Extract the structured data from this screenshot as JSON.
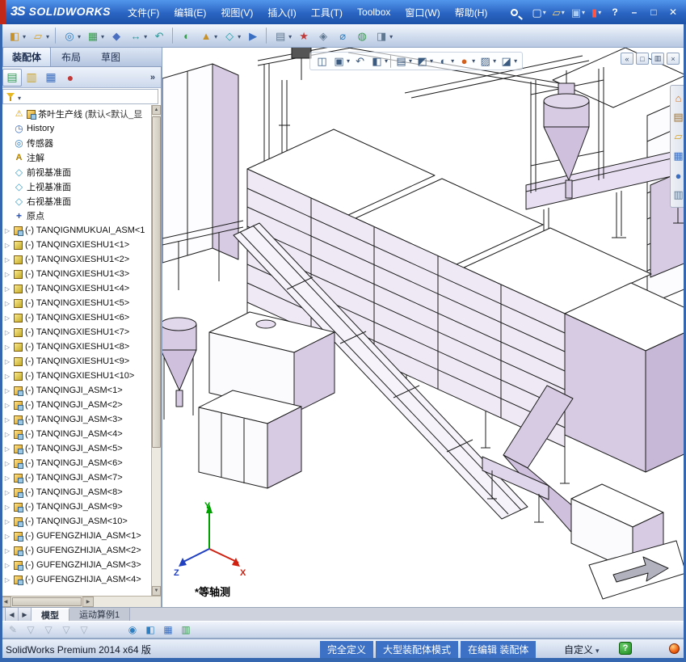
{
  "title_bar": {
    "logo_prefix": "3S",
    "logo_text": "SOLIDWORKS",
    "menus": [
      "文件(F)",
      "编辑(E)",
      "视图(V)",
      "插入(I)",
      "工具(T)",
      "Toolbox",
      "窗口(W)",
      "帮助(H)"
    ],
    "quick_icons": [
      {
        "name": "new-document-button",
        "glyph": "▢",
        "color": "#f0f6ff",
        "dropdown": true
      },
      {
        "name": "open-document-button",
        "glyph": "▱",
        "color": "#ffd878",
        "dropdown": true
      },
      {
        "name": "save-document-button",
        "glyph": "▣",
        "color": "#a8ccf4",
        "dropdown": true
      },
      {
        "name": "record-macro-button",
        "glyph": "▮",
        "color": "#ff5545",
        "dropdown": true
      }
    ],
    "window_controls": [
      {
        "name": "help-button",
        "glyph": "?"
      },
      {
        "name": "minimize-button",
        "glyph": "–"
      },
      {
        "name": "maximize-button",
        "glyph": "□"
      },
      {
        "name": "close-button",
        "glyph": "✕"
      }
    ]
  },
  "main_toolbar": {
    "icons": [
      {
        "name": "insert-component",
        "glyph": "◧",
        "color": "#c8922a",
        "dropdown": true
      },
      {
        "name": "open-part",
        "glyph": "▱",
        "color": "#d8a020",
        "dropdown": true
      },
      {
        "sep": true
      },
      {
        "name": "mate",
        "glyph": "◎",
        "color": "#2f7fc0",
        "dropdown": true
      },
      {
        "name": "component-pattern",
        "glyph": "▦",
        "color": "#3a9a50",
        "dropdown": true
      },
      {
        "name": "smart-fasteners",
        "glyph": "◆",
        "color": "#4a6ec0"
      },
      {
        "name": "move-component",
        "glyph": "↔",
        "color": "#2f9a9a",
        "dropdown": true
      },
      {
        "name": "rotate-component",
        "glyph": "↶",
        "color": "#2f9a9a"
      },
      {
        "sep": true
      },
      {
        "name": "show-hidden-components",
        "glyph": "◐",
        "color": "#3a9a50"
      },
      {
        "name": "assembly-features",
        "glyph": "▲",
        "color": "#c8922a",
        "dropdown": true
      },
      {
        "name": "reference-geometry",
        "glyph": "◇",
        "color": "#20a0a8",
        "dropdown": true
      },
      {
        "name": "new-motion-study",
        "glyph": "▶",
        "color": "#3a6ec0"
      },
      {
        "sep": true
      },
      {
        "name": "bill-of-materials",
        "glyph": "▤",
        "color": "#607890",
        "dropdown": true
      },
      {
        "name": "exploded-view",
        "glyph": "★",
        "color": "#c03a3a"
      },
      {
        "name": "interference-detection",
        "glyph": "◈",
        "color": "#607890"
      },
      {
        "name": "measure",
        "glyph": "⌀",
        "color": "#2f7fc0"
      },
      {
        "name": "mass-properties",
        "glyph": "◍",
        "color": "#3a9a50"
      },
      {
        "name": "section-properties",
        "glyph": "◨",
        "color": "#607890",
        "dropdown": true
      }
    ]
  },
  "command_tabs": {
    "tabs": [
      {
        "label": "装配体",
        "active": true
      },
      {
        "label": "布局"
      },
      {
        "label": "草图"
      }
    ]
  },
  "feature_panel": {
    "tabs": [
      {
        "name": "featuremanager-tab",
        "glyph": "▤",
        "color": "#2f9a50",
        "active": true
      },
      {
        "name": "propertymanager-tab",
        "glyph": "▥",
        "color": "#caa22a"
      },
      {
        "name": "configurationmanager-tab",
        "glyph": "▦",
        "color": "#3a6ec0"
      },
      {
        "name": "displaymanager-tab",
        "glyph": "●",
        "color": "#c03a3a"
      }
    ],
    "overflow_glyph": "»",
    "root": {
      "label": "茶叶生产线",
      "config": "(默认<默认_显"
    },
    "items": [
      {
        "icon": "history",
        "label": "History"
      },
      {
        "icon": "sensors",
        "label": "传感器"
      },
      {
        "icon": "annotations",
        "label": "注解"
      },
      {
        "icon": "plane",
        "label": "前视基准面"
      },
      {
        "icon": "plane",
        "label": "上视基准面"
      },
      {
        "icon": "plane",
        "label": "右视基准面"
      },
      {
        "icon": "origin",
        "label": "原点"
      },
      {
        "icon": "assembly",
        "arrow": true,
        "label": "(-) TANQIGNMUKUAI_ASM<1"
      },
      {
        "icon": "part",
        "arrow": true,
        "label": "(-) TANQINGXIESHU1<1>"
      },
      {
        "icon": "part",
        "arrow": true,
        "label": "(-) TANQINGXIESHU1<2>"
      },
      {
        "icon": "part",
        "arrow": true,
        "label": "(-) TANQINGXIESHU1<3>"
      },
      {
        "icon": "part",
        "arrow": true,
        "label": "(-) TANQINGXIESHU1<4>"
      },
      {
        "icon": "part",
        "arrow": true,
        "label": "(-) TANQINGXIESHU1<5>"
      },
      {
        "icon": "part",
        "arrow": true,
        "label": "(-) TANQINGXIESHU1<6>"
      },
      {
        "icon": "part",
        "arrow": true,
        "label": "(-) TANQINGXIESHU1<7>"
      },
      {
        "icon": "part",
        "arrow": true,
        "label": "(-) TANQINGXIESHU1<8>"
      },
      {
        "icon": "part",
        "arrow": true,
        "label": "(-) TANQINGXIESHU1<9>"
      },
      {
        "icon": "part",
        "arrow": true,
        "label": "(-) TANQINGXIESHU1<10>"
      },
      {
        "icon": "assembly",
        "arrow": true,
        "label": "(-) TANQINGJI_ASM<1>"
      },
      {
        "icon": "assembly",
        "arrow": true,
        "label": "(-) TANQINGJI_ASM<2>"
      },
      {
        "icon": "assembly",
        "arrow": true,
        "label": "(-) TANQINGJI_ASM<3>"
      },
      {
        "icon": "assembly",
        "arrow": true,
        "label": "(-) TANQINGJI_ASM<4>"
      },
      {
        "icon": "assembly",
        "arrow": true,
        "label": "(-) TANQINGJI_ASM<5>"
      },
      {
        "icon": "assembly",
        "arrow": true,
        "label": "(-) TANQINGJI_ASM<6>"
      },
      {
        "icon": "assembly",
        "arrow": true,
        "label": "(-) TANQINGJI_ASM<7>"
      },
      {
        "icon": "assembly",
        "arrow": true,
        "label": "(-) TANQINGJI_ASM<8>"
      },
      {
        "icon": "assembly",
        "arrow": true,
        "label": "(-) TANQINGJI_ASM<9>"
      },
      {
        "icon": "assembly",
        "arrow": true,
        "label": "(-) TANQINGJI_ASM<10>"
      },
      {
        "icon": "assembly",
        "arrow": true,
        "label": "(-) GUFENGZHIJIA_ASM<1>"
      },
      {
        "icon": "assembly",
        "arrow": true,
        "label": "(-) GUFENGZHIJIA_ASM<2>"
      },
      {
        "icon": "assembly",
        "arrow": true,
        "label": "(-) GUFENGZHIJIA_ASM<3>"
      },
      {
        "icon": "assembly",
        "arrow": true,
        "label": "(-) GUFENGZHIJIA_ASM<4>"
      }
    ]
  },
  "viewport": {
    "view_label": "*等轴测",
    "triad": {
      "x": "X",
      "y": "Y",
      "z": "Z"
    },
    "headsup_icons": [
      {
        "name": "zoom-fit",
        "glyph": "◫",
        "color": "#3a5a80"
      },
      {
        "name": "zoom-area",
        "glyph": "▣",
        "color": "#3a5a80",
        "dropdown": true
      },
      {
        "name": "previous-view",
        "glyph": "↶",
        "color": "#3a5a80"
      },
      {
        "name": "section-view",
        "glyph": "◧",
        "color": "#3a5a80",
        "dropdown": true
      },
      {
        "sep": true
      },
      {
        "name": "view-orientation",
        "glyph": "▤",
        "color": "#3a5a80",
        "dropdown": true
      },
      {
        "name": "display-style",
        "glyph": "◩",
        "color": "#3a5a80",
        "dropdown": true
      },
      {
        "name": "hide-show-items",
        "glyph": "◐",
        "color": "#3a5a80",
        "dropdown": true
      },
      {
        "name": "edit-appearance",
        "glyph": "●",
        "color": "#d06020",
        "dropdown": true
      },
      {
        "name": "apply-scene",
        "glyph": "▨",
        "color": "#3a5a80",
        "dropdown": true
      },
      {
        "name": "view-settings",
        "glyph": "◪",
        "color": "#3a5a80",
        "dropdown": true
      }
    ],
    "doc_window_icons": [
      {
        "name": "collapse-taskpane",
        "glyph": "«"
      },
      {
        "name": "restore-document-window",
        "glyph": "□"
      },
      {
        "name": "show-display-pane",
        "glyph": "▥"
      },
      {
        "name": "close-document",
        "glyph": "×"
      }
    ],
    "taskpane_icons": [
      {
        "name": "solidworks-resources",
        "glyph": "⌂",
        "color": "#d07020"
      },
      {
        "name": "design-library",
        "glyph": "▤",
        "color": "#a07030"
      },
      {
        "name": "file-explorer",
        "glyph": "▱",
        "color": "#d8a020"
      },
      {
        "name": "view-palette",
        "glyph": "▦",
        "color": "#3a6ec0"
      },
      {
        "name": "appearances-scenes",
        "glyph": "●",
        "color": "#3a6ec0"
      },
      {
        "name": "custom-properties",
        "glyph": "▥",
        "color": "#607890"
      }
    ]
  },
  "sheet_tabs": {
    "scrollers": [
      {
        "name": "scroll-tabs-left",
        "glyph": "◀"
      },
      {
        "name": "scroll-tabs-right",
        "glyph": "▶"
      }
    ],
    "tabs": [
      {
        "label": "模型",
        "active": true
      },
      {
        "label": "运动算例1"
      }
    ]
  },
  "bottom_toolbar": {
    "icons": [
      {
        "name": "edit-sketch",
        "glyph": "✎",
        "color": "#708090",
        "disabled": true
      },
      {
        "name": "selection-filter-toggle",
        "glyph": "▽",
        "color": "#708090",
        "disabled": true
      },
      {
        "name": "filter-faces",
        "glyph": "▽",
        "color": "#708090",
        "disabled": true
      },
      {
        "name": "filter-edges",
        "glyph": "▽",
        "color": "#708090",
        "disabled": true
      },
      {
        "name": "filter-vertices",
        "glyph": "▽",
        "color": "#708090",
        "disabled": true
      },
      {
        "spacer": true
      },
      {
        "name": "magnified-selection",
        "glyph": "◉",
        "color": "#2f7fc0"
      },
      {
        "name": "assembly-visualization",
        "glyph": "◧",
        "color": "#2f7fc0"
      },
      {
        "name": "show-display-pane",
        "glyph": "▦",
        "color": "#3a6ec0"
      },
      {
        "name": "selection-grid",
        "glyph": "▥",
        "color": "#3a9a50"
      }
    ]
  },
  "status_bar": {
    "app_info": "SolidWorks Premium 2014 x64 版",
    "segments": [
      "完全定义",
      "大型装配体模式",
      "在编辑 装配体"
    ],
    "custom_label": "自定义",
    "help_glyph": "?"
  }
}
